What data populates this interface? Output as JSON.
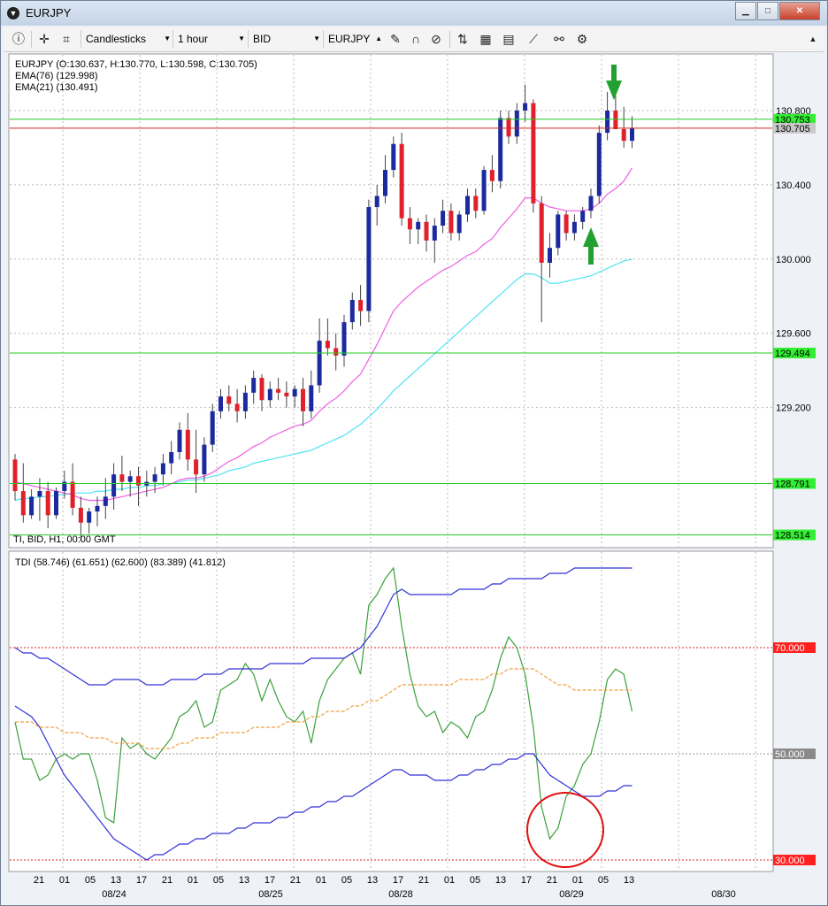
{
  "window": {
    "title": "EURJPY",
    "buttons": [
      "▁",
      "□",
      "✕"
    ]
  },
  "toolbar": {
    "chart_type": "Candlesticks",
    "timeframe": "1 hour",
    "price_type": "BID",
    "symbol": "EURJPY"
  },
  "colors": {
    "bull": "#1c2aa0",
    "bear": "#e0202a",
    "ema76": "#4fe3f4",
    "ema21": "#ee5fe3",
    "tdi_green": "#3aa03a",
    "tdi_blue": "#3232d8",
    "tdi_orange": "#f0a040",
    "hline_green": "#22cc22",
    "hline_red": "#d82020",
    "circle": "#e01010"
  },
  "main_panel": {
    "legend": [
      "EURJPY (O:130.637, H:130.770, L:130.598, C:130.705)",
      "EMA(76) (129.998)",
      "EMA(21) (130.491)"
    ],
    "footer": "TI, BID, H1, 00:00 GMT"
  },
  "tdi_panel": {
    "legend": "TDI (58.746) (61.651) (62.600) (83.389) (41.812)"
  },
  "chart_data": [
    {
      "type": "candlestick",
      "title": "",
      "ylim": [
        128.45,
        131.1
      ],
      "y_ticks": [
        "130.800",
        "130.400",
        "130.000",
        "129.600",
        "129.200"
      ],
      "price_labels": [
        {
          "value": 130.753,
          "label": "130.753",
          "style": "green"
        },
        {
          "value": 130.705,
          "label": "130.705",
          "style": "red"
        },
        {
          "value": 129.494,
          "label": "129.494",
          "style": "green"
        },
        {
          "value": 128.791,
          "label": "128.791",
          "style": "green"
        },
        {
          "value": 128.514,
          "label": "128.514",
          "style": "green"
        }
      ],
      "candles": [
        [
          128.92,
          128.95,
          128.7,
          128.75
        ],
        [
          128.75,
          128.9,
          128.58,
          128.62
        ],
        [
          128.62,
          128.76,
          128.6,
          128.72
        ],
        [
          128.72,
          128.82,
          128.59,
          128.75
        ],
        [
          128.75,
          128.8,
          128.55,
          128.62
        ],
        [
          128.62,
          128.77,
          128.6,
          128.75
        ],
        [
          128.75,
          128.86,
          128.71,
          128.8
        ],
        [
          128.8,
          128.9,
          128.62,
          128.66
        ],
        [
          128.66,
          128.72,
          128.48,
          128.58
        ],
        [
          128.58,
          128.66,
          128.52,
          128.64
        ],
        [
          128.64,
          128.72,
          128.56,
          128.67
        ],
        [
          128.67,
          128.82,
          128.6,
          128.72
        ],
        [
          128.72,
          128.9,
          128.65,
          128.84
        ],
        [
          128.84,
          128.94,
          128.75,
          128.8
        ],
        [
          128.8,
          128.86,
          128.72,
          128.83
        ],
        [
          128.83,
          128.88,
          128.67,
          128.78
        ],
        [
          128.78,
          128.86,
          128.72,
          128.8
        ],
        [
          128.8,
          128.88,
          128.74,
          128.84
        ],
        [
          128.84,
          128.95,
          128.78,
          128.9
        ],
        [
          128.9,
          129.02,
          128.84,
          128.96
        ],
        [
          128.96,
          129.12,
          128.92,
          129.08
        ],
        [
          129.08,
          129.17,
          128.86,
          128.92
        ],
        [
          128.92,
          129.08,
          128.74,
          128.84
        ],
        [
          128.84,
          129.04,
          128.8,
          129.0
        ],
        [
          129.0,
          129.22,
          128.96,
          129.18
        ],
        [
          129.18,
          129.3,
          129.14,
          129.26
        ],
        [
          129.26,
          129.32,
          129.18,
          129.22
        ],
        [
          129.22,
          129.3,
          129.12,
          129.18
        ],
        [
          129.18,
          129.32,
          129.14,
          129.28
        ],
        [
          129.28,
          129.4,
          129.22,
          129.36
        ],
        [
          129.36,
          129.38,
          129.18,
          129.24
        ],
        [
          129.24,
          129.34,
          129.2,
          129.3
        ],
        [
          129.3,
          129.36,
          129.24,
          129.28
        ],
        [
          129.28,
          129.34,
          129.2,
          129.26
        ],
        [
          129.26,
          129.32,
          129.2,
          129.3
        ],
        [
          129.3,
          129.36,
          129.1,
          129.18
        ],
        [
          129.18,
          129.4,
          129.14,
          129.32
        ],
        [
          129.32,
          129.68,
          129.28,
          129.56
        ],
        [
          129.56,
          129.68,
          129.48,
          129.52
        ],
        [
          129.52,
          129.6,
          129.4,
          129.48
        ],
        [
          129.48,
          129.7,
          129.42,
          129.66
        ],
        [
          129.66,
          129.82,
          129.62,
          129.78
        ],
        [
          129.78,
          129.86,
          129.64,
          129.72
        ],
        [
          129.72,
          130.32,
          129.66,
          130.28
        ],
        [
          130.28,
          130.4,
          130.18,
          130.34
        ],
        [
          130.34,
          130.56,
          130.3,
          130.48
        ],
        [
          130.48,
          130.66,
          130.44,
          130.62
        ],
        [
          130.62,
          130.68,
          130.18,
          130.22
        ],
        [
          130.22,
          130.28,
          130.08,
          130.16
        ],
        [
          130.16,
          130.22,
          130.08,
          130.2
        ],
        [
          130.2,
          130.24,
          130.04,
          130.1
        ],
        [
          130.1,
          130.22,
          129.98,
          130.18
        ],
        [
          130.18,
          130.32,
          130.14,
          130.26
        ],
        [
          130.26,
          130.3,
          130.1,
          130.14
        ],
        [
          130.14,
          130.26,
          130.1,
          130.24
        ],
        [
          130.24,
          130.38,
          130.2,
          130.34
        ],
        [
          130.34,
          130.38,
          130.22,
          130.26
        ],
        [
          130.26,
          130.5,
          130.24,
          130.48
        ],
        [
          130.48,
          130.56,
          130.36,
          130.42
        ],
        [
          130.42,
          130.8,
          130.38,
          130.76
        ],
        [
          130.76,
          130.8,
          130.62,
          130.66
        ],
        [
          130.66,
          130.84,
          130.62,
          130.8
        ],
        [
          130.8,
          130.94,
          130.74,
          130.84
        ],
        [
          130.84,
          130.86,
          130.25,
          130.3
        ],
        [
          130.3,
          130.34,
          129.66,
          129.98
        ],
        [
          129.98,
          130.14,
          129.9,
          130.06
        ],
        [
          130.06,
          130.26,
          130.02,
          130.24
        ],
        [
          130.24,
          130.26,
          130.1,
          130.14
        ],
        [
          130.14,
          130.24,
          130.1,
          130.2
        ],
        [
          130.2,
          130.28,
          130.16,
          130.26
        ],
        [
          130.26,
          130.38,
          130.22,
          130.34
        ],
        [
          130.34,
          130.72,
          130.3,
          130.68
        ],
        [
          130.68,
          130.9,
          130.64,
          130.8
        ],
        [
          130.8,
          130.88,
          130.7,
          130.7
        ],
        [
          130.7,
          130.82,
          130.6,
          130.637
        ],
        [
          130.637,
          130.77,
          130.598,
          130.705
        ]
      ],
      "ema76": [
        128.7,
        128.71,
        128.71,
        128.72,
        128.72,
        128.73,
        128.73,
        128.74,
        128.74,
        128.74,
        128.75,
        128.75,
        128.76,
        128.76,
        128.77,
        128.77,
        128.78,
        128.78,
        128.79,
        128.79,
        128.8,
        128.81,
        128.81,
        128.82,
        128.83,
        128.84,
        128.86,
        128.87,
        128.88,
        128.9,
        128.91,
        128.92,
        128.93,
        128.94,
        128.95,
        128.96,
        128.97,
        128.99,
        129.01,
        129.03,
        129.05,
        129.08,
        129.11,
        129.15,
        129.19,
        129.24,
        129.29,
        129.33,
        129.37,
        129.41,
        129.45,
        129.49,
        129.53,
        129.57,
        129.61,
        129.65,
        129.69,
        129.73,
        129.77,
        129.81,
        129.85,
        129.89,
        129.92,
        129.92,
        129.9,
        129.87,
        129.87,
        129.88,
        129.89,
        129.9,
        129.91,
        129.93,
        129.95,
        129.97,
        129.99,
        129.998
      ],
      "ema21": [
        128.8,
        128.79,
        128.78,
        128.77,
        128.76,
        128.75,
        128.74,
        128.73,
        128.71,
        128.7,
        128.7,
        128.7,
        128.71,
        128.72,
        128.73,
        128.74,
        128.75,
        128.76,
        128.77,
        128.79,
        128.81,
        128.82,
        128.82,
        128.83,
        128.85,
        128.88,
        128.91,
        128.93,
        128.96,
        128.99,
        129.01,
        129.04,
        129.06,
        129.08,
        129.1,
        129.11,
        129.13,
        129.18,
        129.22,
        129.25,
        129.29,
        129.34,
        129.38,
        129.46,
        129.54,
        129.63,
        129.72,
        129.77,
        129.81,
        129.85,
        129.88,
        129.91,
        129.94,
        129.96,
        129.99,
        130.02,
        130.04,
        130.08,
        130.11,
        130.17,
        130.22,
        130.27,
        130.33,
        130.33,
        130.3,
        130.28,
        130.27,
        130.26,
        130.26,
        130.26,
        130.27,
        130.3,
        130.35,
        130.38,
        130.42,
        130.491
      ]
    },
    {
      "type": "line",
      "title": "",
      "ylim": [
        28,
        88
      ],
      "y_ticks": [
        {
          "value": 70,
          "label": "70.000",
          "style": "red"
        },
        {
          "value": 50,
          "label": "50.000",
          "style": "gray"
        },
        {
          "value": 30,
          "label": "30.000",
          "style": "red"
        }
      ],
      "series": [
        {
          "values": [
            56,
            49,
            49,
            45,
            46,
            49,
            50,
            49,
            50,
            50,
            45,
            38,
            37,
            53,
            51,
            52,
            50,
            49,
            51,
            53,
            57,
            58,
            60,
            55,
            56,
            62,
            63,
            64,
            67,
            65,
            60,
            64,
            60,
            57,
            56,
            58,
            52,
            60,
            64,
            66,
            68,
            69,
            65,
            78,
            80,
            83,
            85,
            74,
            65,
            59,
            57,
            58,
            54,
            56,
            55,
            53,
            57,
            58,
            62,
            68,
            72,
            70,
            65,
            55,
            40,
            34,
            36,
            42,
            44,
            48,
            50,
            56,
            64,
            66,
            65,
            58
          ]
        },
        {
          "values": [
            59,
            58,
            57,
            55,
            52,
            49,
            46,
            44,
            42,
            40,
            38,
            36,
            34,
            33,
            32,
            31,
            30,
            31,
            31,
            32,
            33,
            33,
            34,
            34,
            35,
            35,
            35,
            36,
            36,
            37,
            37,
            37,
            38,
            38,
            39,
            39,
            40,
            40,
            41,
            41,
            42,
            42,
            43,
            44,
            45,
            46,
            47,
            47,
            46,
            46,
            46,
            45,
            45,
            45,
            46,
            46,
            47,
            47,
            48,
            48,
            49,
            49,
            50,
            50,
            48,
            46,
            45,
            44,
            43,
            42,
            42,
            42,
            43,
            43,
            44,
            44
          ]
        },
        {
          "values": [
            70,
            69,
            69,
            68,
            68,
            67,
            66,
            65,
            64,
            63,
            63,
            63,
            64,
            64,
            64,
            64,
            63,
            63,
            63,
            64,
            64,
            64,
            64,
            65,
            65,
            65,
            66,
            66,
            66,
            66,
            66,
            67,
            67,
            67,
            67,
            67,
            68,
            68,
            68,
            68,
            68,
            69,
            70,
            72,
            74,
            77,
            80,
            81,
            80,
            80,
            80,
            80,
            80,
            80,
            81,
            81,
            81,
            81,
            82,
            82,
            83,
            83,
            83,
            83,
            83,
            84,
            84,
            84,
            85,
            85,
            85,
            85,
            85,
            85,
            85,
            85
          ]
        },
        {
          "values": [
            56,
            56,
            56,
            55,
            55,
            55,
            54,
            54,
            54,
            53,
            53,
            53,
            52,
            52,
            52,
            52,
            51,
            51,
            51,
            51,
            52,
            52,
            53,
            53,
            53,
            54,
            54,
            54,
            54,
            55,
            55,
            55,
            55,
            56,
            56,
            56,
            57,
            57,
            58,
            58,
            58,
            59,
            59,
            60,
            60,
            61,
            62,
            63,
            63,
            63,
            63,
            63,
            63,
            63,
            64,
            64,
            64,
            64,
            65,
            65,
            66,
            66,
            66,
            66,
            65,
            64,
            63,
            63,
            62,
            62,
            62,
            62,
            62,
            62,
            62,
            62
          ]
        }
      ]
    }
  ],
  "x_axis": {
    "ticks": [
      "21",
      "01",
      "05",
      "13",
      "17",
      "21",
      "01",
      "05",
      "13",
      "17",
      "21",
      "01",
      "05",
      "13",
      "17",
      "21",
      "01",
      "05",
      "13",
      "17",
      "21",
      "01",
      "05",
      "13"
    ],
    "dates": [
      "08/24",
      "08/25",
      "08/28",
      "08/29",
      "08/30"
    ]
  },
  "annotations": [
    {
      "type": "arrow-down",
      "name": "sell-arrow",
      "color": "#22a030"
    },
    {
      "type": "arrow-up",
      "name": "buy-arrow",
      "color": "#22a030"
    },
    {
      "type": "circle",
      "name": "oversold-circle",
      "color": "#e01010"
    }
  ]
}
